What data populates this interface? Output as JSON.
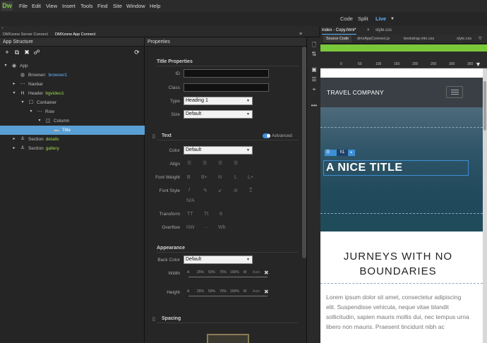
{
  "app": {
    "logo": "Dw"
  },
  "menu": [
    "File",
    "Edit",
    "View",
    "Insert",
    "Tools",
    "Find",
    "Site",
    "Window",
    "Help"
  ],
  "viewmodes": {
    "code": "Code",
    "split": "Split",
    "live": "Live"
  },
  "panel_tabs": [
    "DMXzone Server Connect",
    "DMXzone App Connect"
  ],
  "app_structure": {
    "title": "App Structure",
    "tree": [
      {
        "label": "App",
        "indent": 0,
        "twisty": "▾",
        "icon": "◉"
      },
      {
        "label": "Browser:",
        "value": "browser1",
        "indent": 1,
        "twisty": "",
        "icon": "◍"
      },
      {
        "label": "Navbar",
        "indent": 1,
        "twisty": "▸",
        "icon": "⋯"
      },
      {
        "label": "Header",
        "value": "bgvideo1",
        "indent": 1,
        "twisty": "▾",
        "icon": "H"
      },
      {
        "label": "Container",
        "indent": 2,
        "twisty": "▾",
        "icon": "☐"
      },
      {
        "label": "Row",
        "indent": 3,
        "twisty": "▾",
        "icon": "⋯"
      },
      {
        "label": "Column",
        "indent": 4,
        "twisty": "▾",
        "icon": "◫"
      },
      {
        "label": "Title",
        "indent": 5,
        "twisty": "",
        "icon": "▬",
        "selected": true
      },
      {
        "label": "Section",
        "value": "details",
        "indent": 1,
        "twisty": "▸",
        "icon": "≚"
      },
      {
        "label": "Section",
        "value": "gallery",
        "indent": 1,
        "twisty": "▸",
        "icon": "≚"
      }
    ]
  },
  "properties": {
    "title": "Properties",
    "title_props": "Title Properties",
    "id_label": "ID",
    "class_label": "Class",
    "type_label": "Type",
    "type_value": "Heading 1",
    "size_label": "Size",
    "size_value": "Default",
    "text_section": "Text",
    "advanced": "Advanced",
    "color_label": "Color",
    "color_value": "Default",
    "align_label": "Align",
    "fontweight_label": "Font Weight",
    "fontweight_opts": [
      "B",
      "B+",
      "N",
      "L",
      "L+"
    ],
    "fontstyle_label": "Font Style",
    "fontstyle_na": "N/A",
    "transform_label": "Transform",
    "transform_opts": [
      "TT",
      "Tt",
      "tt"
    ],
    "overflow_label": "Overflow",
    "overflow_opts": [
      "NW",
      "···",
      "Wb"
    ],
    "appearance_section": "Appearance",
    "backcolor_label": "Back Color",
    "backcolor_value": "Default",
    "width_label": "Width",
    "height_label": "Height",
    "scale": [
      "A",
      "25%",
      "50%",
      "75%",
      "100%",
      "M",
      "Auto"
    ],
    "spacing_section": "Spacing"
  },
  "doc": {
    "tabs": [
      "index - Copy.html*",
      "style.css"
    ],
    "files": [
      "Source Code",
      "dmxAppConnect.js",
      "bootstrap.min.css",
      "style.css"
    ],
    "ruler": [
      "0",
      "50",
      "100",
      "150",
      "200",
      "250",
      "300",
      "350"
    ]
  },
  "preview": {
    "brand": "TRAVEL COMPANY",
    "hero_title": "A NICE TITLE",
    "heading": "JURNEYS WITH NO BOUNDARIES",
    "paragraph": "Lorem ipsum dolor sit amet, consectetur adipiscing elit. Suspendisse vehicula, neque vitae blandit sollicitudin, sapien mauris mollis dui, nec tempus urna libero non mauris. Praesent tincidunt nibh ac",
    "badge": "h1"
  }
}
